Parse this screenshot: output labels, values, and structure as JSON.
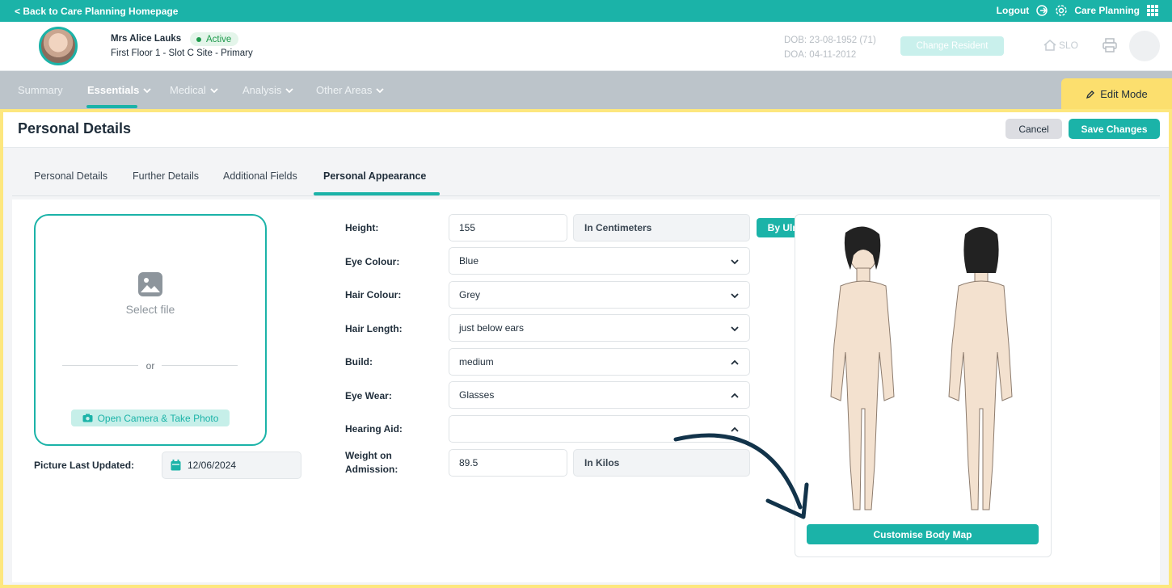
{
  "topbar": {
    "back_label": "< Back to Care Planning Homepage",
    "logout_label": "Logout",
    "app_label": "Care Planning"
  },
  "resident": {
    "name": "Mrs Alice Lauks",
    "status": "Active",
    "location": "First Floor 1 - Slot C Site - Primary",
    "dob": "DOB: 23-08-1952 (71)",
    "doa": "DOA: 04-11-2012",
    "change_label": "Change Resident",
    "home_label": "SLO"
  },
  "nav": {
    "summary": "Summary",
    "essentials": "Essentials",
    "medical": "Medical",
    "analysis": "Analysis",
    "other_areas": "Other Areas",
    "edit_mode": "Edit Mode"
  },
  "page": {
    "title": "Personal Details",
    "cancel_label": "Cancel",
    "save_label": "Save Changes"
  },
  "tabs": {
    "personal_details": "Personal Details",
    "further_details": "Further Details",
    "additional_fields": "Additional Fields",
    "personal_appearance": "Personal Appearance"
  },
  "photo": {
    "select_file": "Select file",
    "or": "or",
    "camera_label": "Open Camera & Take Photo",
    "last_updated_label": "Picture Last Updated:",
    "last_updated_value": "12/06/2024"
  },
  "form": {
    "height_label": "Height:",
    "height_value": "155",
    "height_unit": "In Centimeters",
    "by_ulna": "By Ulna",
    "eye_colour_label": "Eye Colour:",
    "eye_colour_value": "Blue",
    "hair_colour_label": "Hair Colour:",
    "hair_colour_value": "Grey",
    "hair_length_label": "Hair Length:",
    "hair_length_value": "just below ears",
    "build_label": "Build:",
    "build_value": "medium",
    "eye_wear_label": "Eye Wear:",
    "eye_wear_value": "Glasses",
    "hearing_aid_label": "Hearing Aid:",
    "hearing_aid_value": "",
    "weight_label_1": "Weight on",
    "weight_label_2": "Admission:",
    "weight_value": "89.5",
    "weight_unit": "In Kilos"
  },
  "body_map": {
    "button_label": "Customise Body Map"
  },
  "colors": {
    "accent": "#1bb3a8",
    "highlight": "#fde77e",
    "nav_bg": "#bcc4ca"
  },
  "icons": [
    "chevron-left-icon",
    "logout-icon",
    "gear-icon",
    "grid-icon",
    "home-icon",
    "printer-icon",
    "pencil-icon",
    "image-icon",
    "camera-icon",
    "calendar-icon",
    "chevron-down-icon",
    "chevron-up-icon",
    "arrow-icon"
  ]
}
